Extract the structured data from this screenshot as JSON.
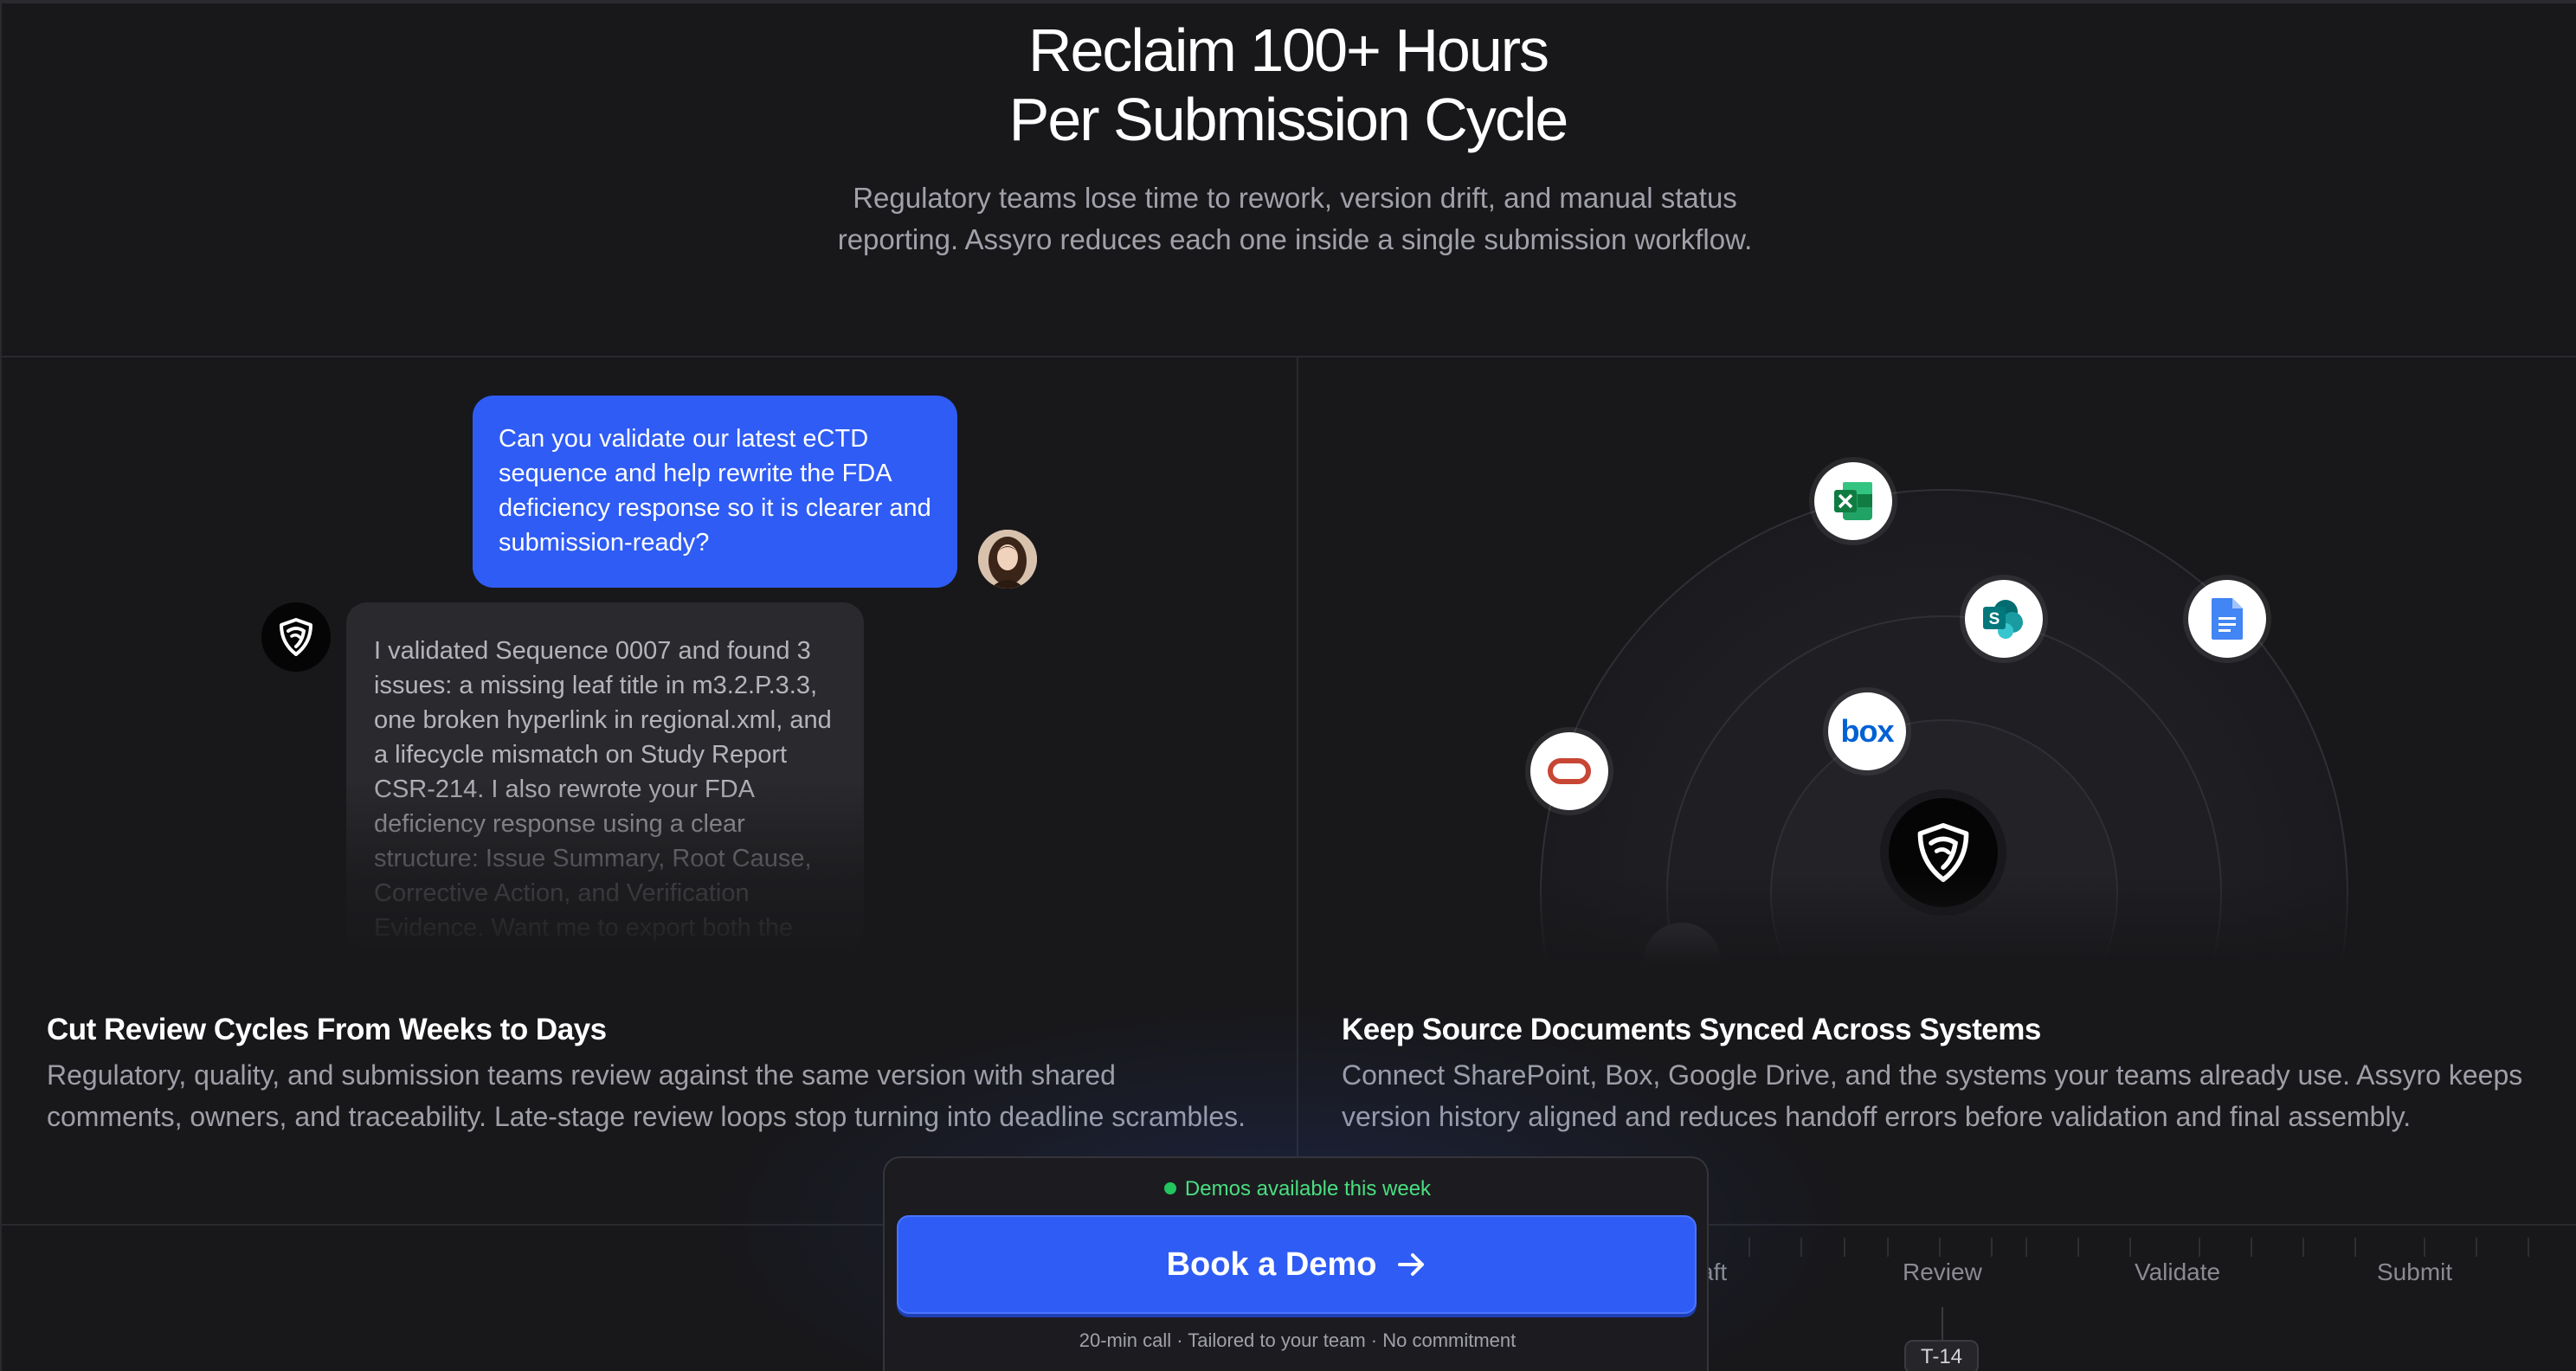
{
  "hero": {
    "title_line1": "Reclaim 100+ Hours",
    "title_line2": "Per Submission Cycle",
    "subtitle": "Regulatory teams lose time to rework, version drift, and manual status reporting. Assyro reduces each one inside a single submission workflow."
  },
  "chat": {
    "user_message": "Can you validate our latest eCTD sequence and help rewrite the FDA deficiency response so it is clearer and submission-ready?",
    "assistant_message": "I validated Sequence 0007 and found 3 issues: a missing leaf title in m3.2.P.3.3, one broken hyperlink in regional.xml, and a lifecycle mismatch on Study Report CSR-214. I also rewrote your FDA deficiency response using a clear structure: Issue Summary, Root Cause, Corrective Action, and Verification Evidence. Want me to export both the validation report and the revised"
  },
  "integrations": {
    "nodes": [
      "excel-icon",
      "sharepoint-icon",
      "google-docs-icon",
      "box-icon",
      "oracle-icon",
      "assyro-logo"
    ],
    "box_label": "box"
  },
  "features": [
    {
      "title": "Cut Review Cycles From Weeks to Days",
      "body": "Regulatory, quality, and submission teams review against the same version with shared comments, owners, and traceability. Late-stage review loops stop turning into deadline scrambles."
    },
    {
      "title": "Keep Source Documents Synced Across Systems",
      "body": "Connect SharePoint, Box, Google Drive, and the systems your teams already use. Assyro keeps version history aligned and reduces handoff errors before validation and final assembly."
    }
  ],
  "timeline": {
    "stages": [
      "aft",
      "Review",
      "Validate",
      "Submit"
    ],
    "marker": "T-14"
  },
  "cta": {
    "status": "Demos available this week",
    "button_label": "Book a Demo",
    "note": "20-min call · Tailored to your team · No commitment"
  },
  "colors": {
    "background": "#18181b",
    "accent": "#2f5cf4",
    "status_green": "#22c55e"
  }
}
